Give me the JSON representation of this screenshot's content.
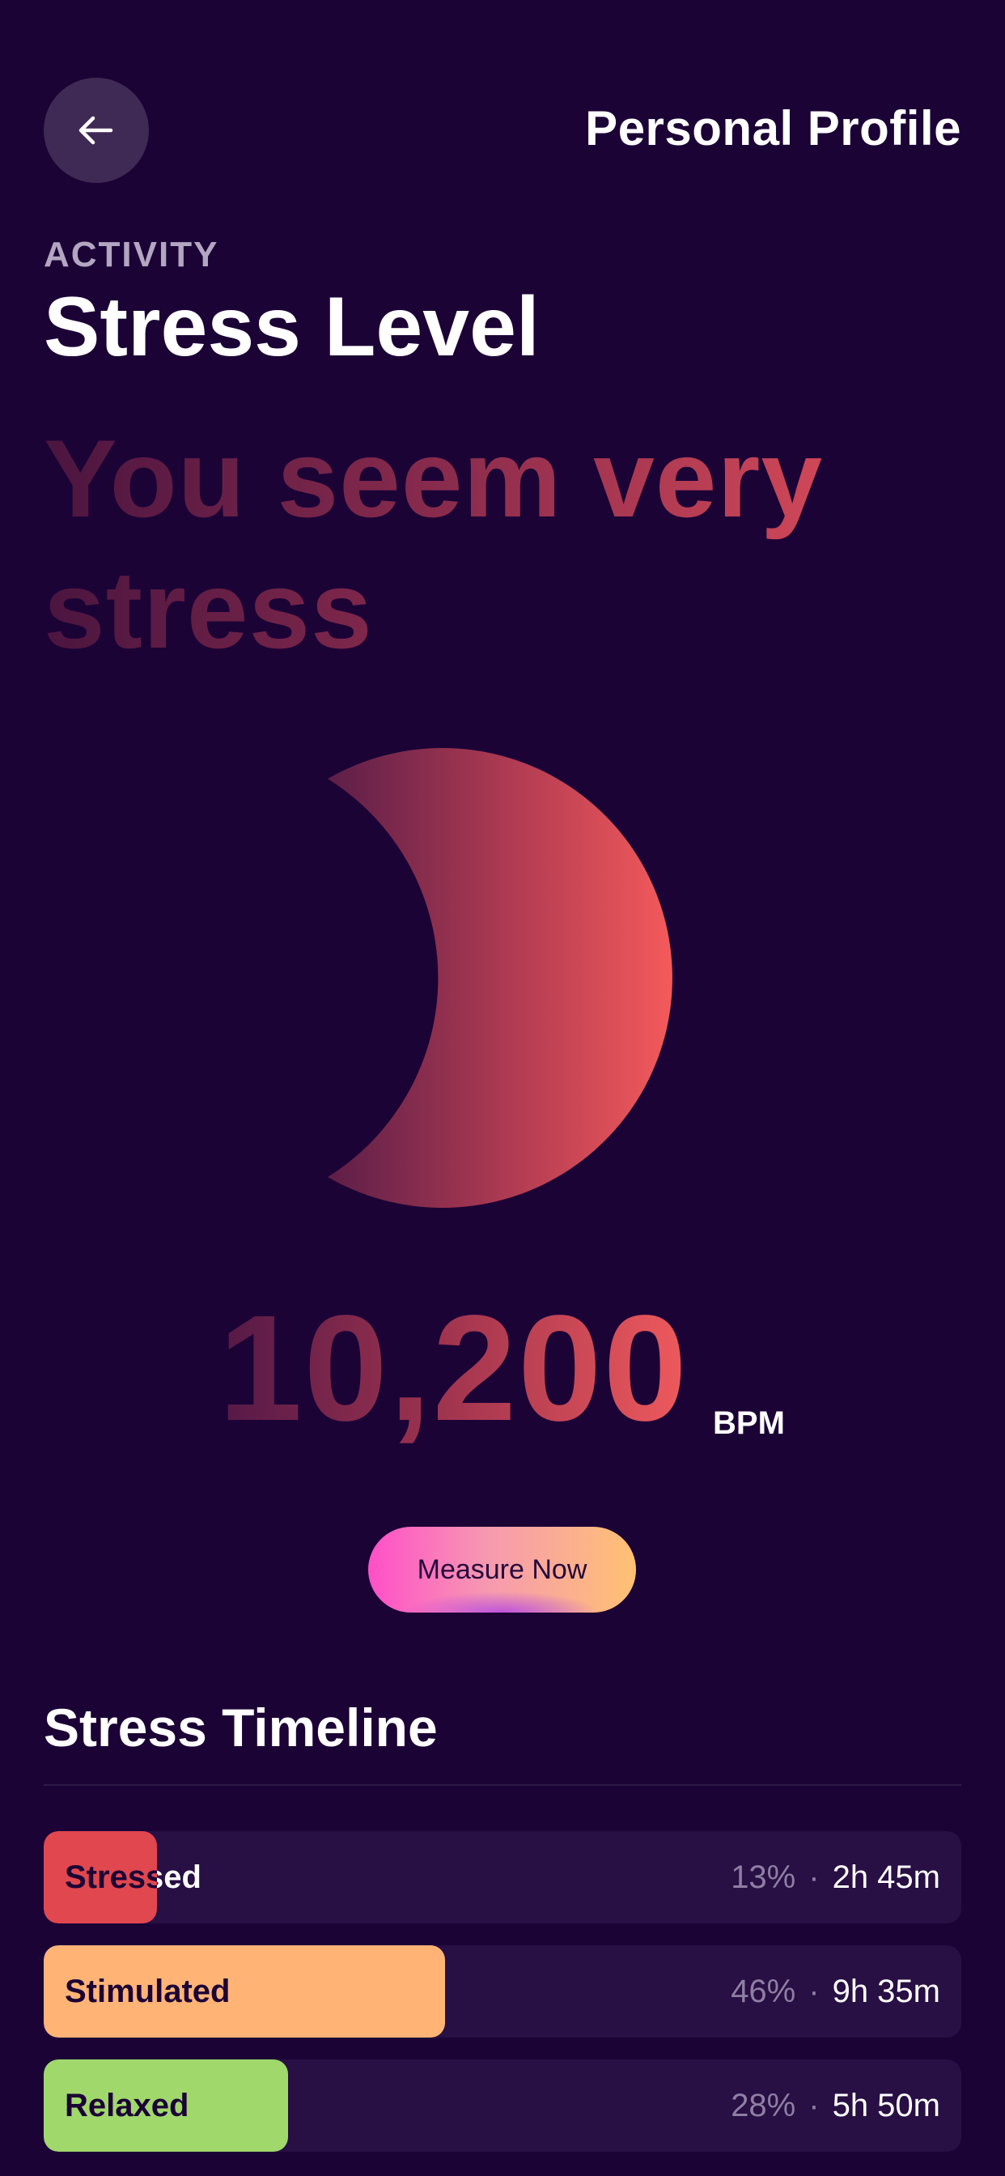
{
  "header": {
    "back_icon": "arrow-left-icon",
    "title": "Personal Profile"
  },
  "section": {
    "eyebrow": "ACTIVITY",
    "heading": "Stress Level"
  },
  "status": {
    "message": "You seem very stress",
    "illustration": "crescent-moon-icon"
  },
  "reading": {
    "value": "10,200",
    "unit": "BPM"
  },
  "actions": {
    "measure_label": "Measure Now"
  },
  "timeline": {
    "title": "Stress Timeline",
    "rows": [
      {
        "label": "Stressed",
        "percent": "13%",
        "percent_value": 0.13,
        "separator": "·",
        "duration": "2h 45m",
        "color": "#e0474f"
      },
      {
        "label": "Stimulated",
        "percent": "46%",
        "percent_value": 0.46,
        "separator": "·",
        "duration": "9h 35m",
        "color": "#ffb476"
      },
      {
        "label": "Relaxed",
        "percent": "28%",
        "percent_value": 0.28,
        "separator": "·",
        "duration": "5h 50m",
        "color": "#a0d86c"
      }
    ]
  },
  "colors": {
    "background": "#1c0336",
    "card": "#280f44",
    "accent_red": "#f25a5c",
    "accent_pink": "#ff4fc8",
    "accent_orange": "#ffc173"
  }
}
